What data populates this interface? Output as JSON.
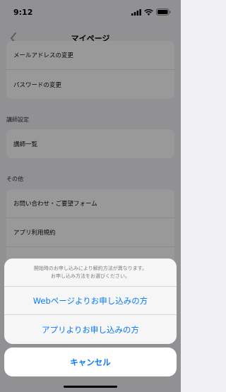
{
  "status_bar": {
    "time": "9:12"
  },
  "navbar": {
    "title": "マイページ"
  },
  "account_group": {
    "items": [
      "メールアドレスの変更",
      "パスワードの変更"
    ]
  },
  "instructor_section": {
    "header": "講師設定",
    "items": [
      "講師一覧"
    ]
  },
  "other_section": {
    "header": "その他",
    "items": [
      "お問い合わせ・ご要望フォーム",
      "アプリ利用規約",
      ""
    ]
  },
  "action_sheet": {
    "message_line1": "開始時のお申し込みにより解約方法が異なります。",
    "message_line2": "お申し込み方法をお選びください。",
    "options": [
      "Webページよりお申し込みの方",
      "アプリよりお申し込みの方"
    ],
    "cancel_label": "キャンセル"
  },
  "colors": {
    "accent": "#0a7aff",
    "background": "#f2f2f7",
    "overlay": "rgba(0,0,0,0.4)"
  }
}
